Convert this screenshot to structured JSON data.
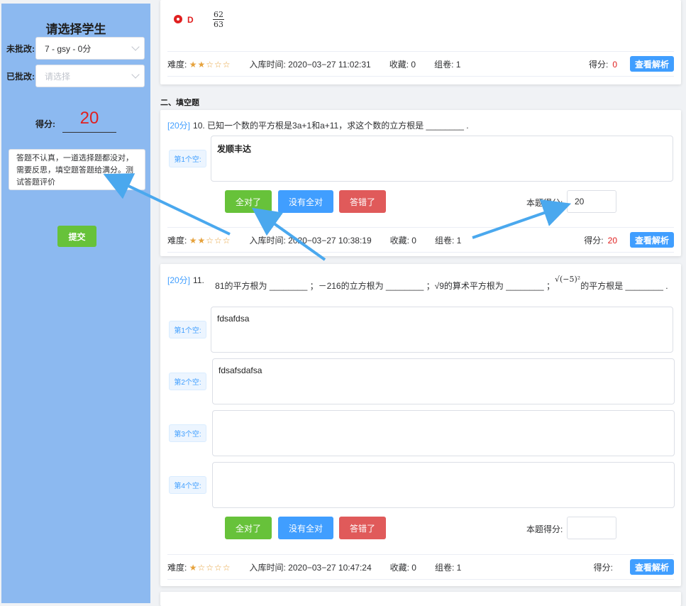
{
  "sidebar": {
    "title": "请选择学生",
    "ungraded_label": "未批改:",
    "ungraded_value": "7 - gsy - 0分",
    "graded_label": "已批改:",
    "graded_placeholder": "请选择",
    "score_label": "得分:",
    "score_value": "20",
    "comment": "答题不认真，一道选择题都没对，需要反思，填空题答题给满分。测试答题评价",
    "submit_label": "提交"
  },
  "card1": {
    "option_letter": "D",
    "fraction_num": "62",
    "fraction_den": "63",
    "meta": {
      "difficulty_label": "难度:",
      "stars": "★★☆☆☆",
      "stored_label": "入库时间:",
      "stored_time": "2020−03−27 11:02:31",
      "fav": "收藏: 0",
      "compose": "组卷: 1",
      "score_label": "得分:",
      "score_value": "0",
      "analysis_btn": "查看解析"
    }
  },
  "section_title": "二、填空题",
  "q10": {
    "points": "[20分]",
    "text": "10.  已知一个数的平方根是3a+1和a+11，求这个数的立方根是 ________  .",
    "blank1_tag": "第1个空:",
    "blank1_answer": "发顺丰达",
    "btn_all_right": "全对了",
    "btn_not_all": "没有全对",
    "btn_wrong": "答错了",
    "score_label": "本题得分:",
    "score_value": "20",
    "meta": {
      "difficulty_label": "难度:",
      "stars": "★★☆☆☆",
      "stored_label": "入库时间:",
      "stored_time": "2020−03−27 10:38:19",
      "fav": "收藏: 0",
      "compose": "组卷: 1",
      "score_label": "得分:",
      "score_value": "20",
      "analysis_btn": "查看解析"
    }
  },
  "q11": {
    "points": "[20分]",
    "num": "11.",
    "text_part1": "81的平方根为 ________  ；－216的立方根为 ________  ；√9的算术平方根为 ________  ；",
    "text_part2": "√(−5)²",
    "text_part3": "的平方根是 ________  .",
    "blank1_tag": "第1个空:",
    "blank1_answer": "fdsafdsa",
    "blank2_tag": "第2个空:",
    "blank2_answer": "fdsafsdafsa",
    "blank3_tag": "第3个空:",
    "blank3_answer": "",
    "blank4_tag": "第4个空:",
    "blank4_answer": "",
    "btn_all_right": "全对了",
    "btn_not_all": "没有全对",
    "btn_wrong": "答错了",
    "score_label": "本题得分:",
    "score_value": "",
    "meta": {
      "difficulty_label": "难度:",
      "stars": "★☆☆☆☆",
      "stored_label": "入库时间:",
      "stored_time": "2020−03−27 10:47:24",
      "fav": "收藏: 0",
      "compose": "组卷: 1",
      "score_label": "得分:",
      "score_value": "",
      "analysis_btn": "查看解析"
    }
  },
  "colors": {
    "accent": "#409eff",
    "success": "#67c23a",
    "danger": "#e05a5a",
    "sidebar": "#8cb9f0",
    "annotation_arrow": "#4aa8ee"
  }
}
